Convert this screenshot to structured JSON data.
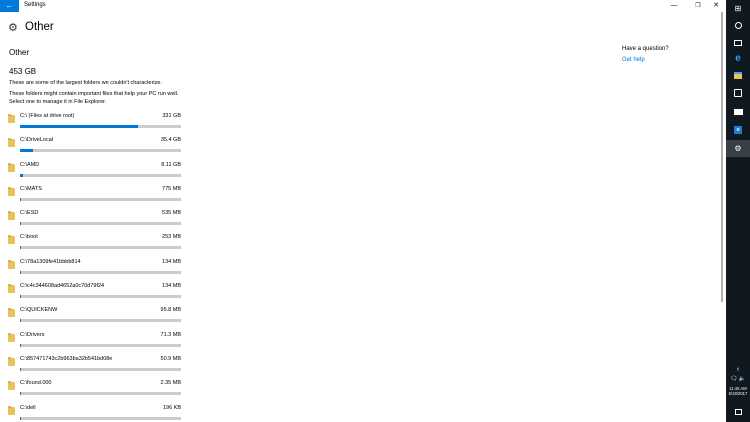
{
  "window": {
    "back_glyph": "←",
    "app_title": "Settings",
    "minimize_glyph": "—",
    "maximize_glyph": "❐",
    "close_glyph": "✕"
  },
  "header": {
    "title": "Other",
    "icon": "gear-icon"
  },
  "content": {
    "section_title": "Other",
    "total_size": "453 GB",
    "description_1": "These are some of the largest folders we couldn't characterize.",
    "description_2": "These folders might contain important files that help your PC run well. Select one to manage it in File Explorer."
  },
  "folders": [
    {
      "name": "C:\\ (Files at drive root)",
      "size": "331 GB",
      "fraction": 0.73
    },
    {
      "name": "C:\\DriveLocal",
      "size": "35.4 GB",
      "fraction": 0.08
    },
    {
      "name": "C:\\AMD",
      "size": "8.11 GB",
      "fraction": 0.018
    },
    {
      "name": "C:\\MATS",
      "size": "775 MB",
      "fraction": 0.006
    },
    {
      "name": "C:\\ESD",
      "size": "535 MB",
      "fraction": 0.006
    },
    {
      "name": "C:\\boot",
      "size": "253 MB",
      "fraction": 0.006
    },
    {
      "name": "C:\\78a1309fe41bbbb814",
      "size": "134 MB",
      "fraction": 0.006
    },
    {
      "name": "C:\\c4c344608ad4652a0c70d79f24",
      "size": "134 MB",
      "fraction": 0.006
    },
    {
      "name": "C:\\QUICKENW",
      "size": "95.8 MB",
      "fraction": 0.006
    },
    {
      "name": "C:\\Drivers",
      "size": "71.3 MB",
      "fraction": 0.006
    },
    {
      "name": "C:\\857471743c2b963ba32b541bd08e",
      "size": "50.9 MB",
      "fraction": 0.006
    },
    {
      "name": "C:\\found.000",
      "size": "2.35 MB",
      "fraction": 0.006
    },
    {
      "name": "C:\\dell",
      "size": "196 KB",
      "fraction": 0.006
    }
  ],
  "help": {
    "question": "Have a question?",
    "link": "Get help"
  },
  "taskbar": {
    "time": "11:45 AM",
    "date": "5/19/2017",
    "chevron_glyph": "‹",
    "tray_glyph": "🗨 🔈",
    "start_glyph": "⊞",
    "edge_glyph": "e",
    "settings_glyph": "⚙",
    "outlook_glyph": "o",
    "items": [
      "start-icon",
      "cortana-icon",
      "task-view-icon",
      "edge-icon",
      "file-explorer-icon",
      "store-icon",
      "mail-icon",
      "outlook-icon",
      "settings-icon"
    ]
  },
  "colors": {
    "accent": "#0078d7",
    "bar_track": "#cccccc",
    "folder": "#e8c25a",
    "taskbar": "#101820"
  }
}
